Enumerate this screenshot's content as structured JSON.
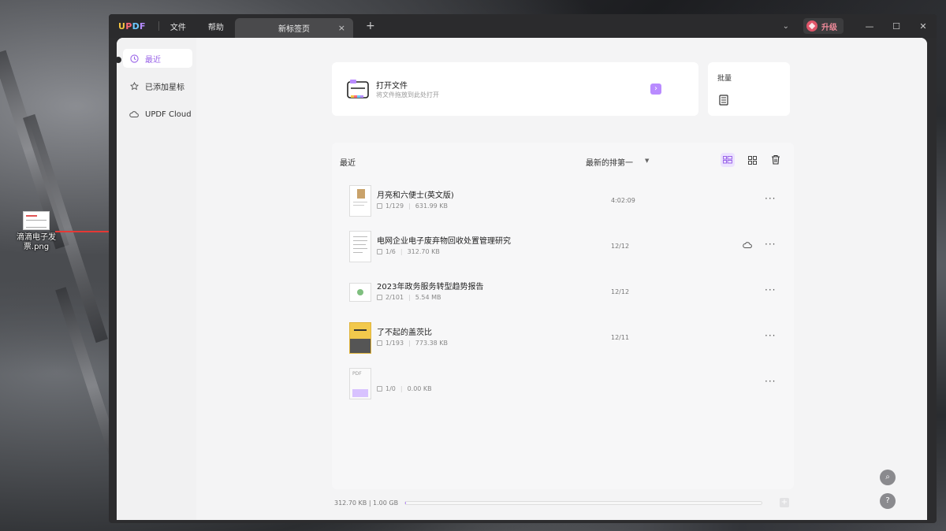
{
  "desktop": {
    "file_label": "滴滴电子发票.png"
  },
  "titlebar": {
    "logo_letters": [
      "U",
      "P",
      "D",
      "F"
    ],
    "menus": [
      "文件",
      "帮助"
    ],
    "tab_label": "新标签页",
    "tab_close": "×",
    "new_tab": "+",
    "upgrade_label": "升级",
    "chevron": "⌄",
    "minimize": "—",
    "maximize": "☐",
    "close": "✕"
  },
  "sidebar": {
    "items": [
      {
        "label": "最近",
        "icon": "clock-icon",
        "active": true
      },
      {
        "label": "已添加星标",
        "icon": "star-icon",
        "active": false
      },
      {
        "label": "UPDF Cloud",
        "icon": "cloud-icon",
        "active": false
      }
    ]
  },
  "open_file": {
    "title": "打开文件",
    "subtitle": "将文件拖放到此处打开",
    "go": "›"
  },
  "batch": {
    "title": "批量"
  },
  "recent": {
    "title": "最近",
    "sort_label": "最新的排第一",
    "files": [
      {
        "name": "月亮和六便士(英文版)",
        "pages": "1/129",
        "size": "631.99 KB",
        "date": "4:02:09",
        "cloud": false
      },
      {
        "name": "电网企业电子废弃物回收处置管理研究",
        "pages": "1/6",
        "size": "312.70 KB",
        "date": "12/12",
        "cloud": true
      },
      {
        "name": "2023年政务服务转型趋势报告",
        "pages": "2/101",
        "size": "5.54 MB",
        "date": "12/12",
        "cloud": false
      },
      {
        "name": "了不起的盖茨比",
        "pages": "1/193",
        "size": "773.38 KB",
        "date": "12/11",
        "cloud": false
      },
      {
        "name": "",
        "pages": "1/0",
        "size": "0.00 KB",
        "date": "",
        "cloud": false
      }
    ],
    "more": "···"
  },
  "storage": {
    "label": "312.70 KB | 1.00 GB",
    "used_fraction": 0.0003,
    "plus": "+"
  },
  "float": {
    "search": "⌕",
    "help": "?"
  },
  "colors": {
    "accent": "#9b66e8",
    "titlebar": "#2b2b2d",
    "upgrade": "#e0566a"
  }
}
